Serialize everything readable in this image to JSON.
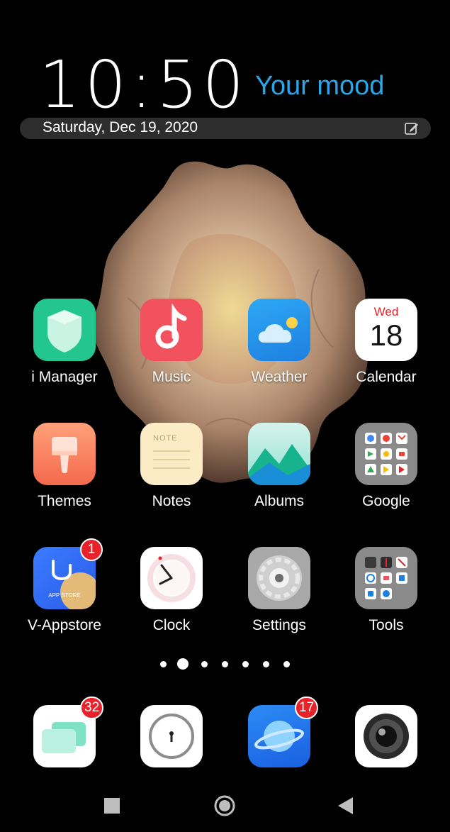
{
  "lockscreen": {
    "time": "10:50",
    "mood": "Your mood",
    "date": "Saturday, Dec 19, 2020"
  },
  "apps": [
    {
      "id": "i-manager",
      "label": "i Manager",
      "icon": "shield-icon"
    },
    {
      "id": "music",
      "label": "Music",
      "icon": "music-note-icon"
    },
    {
      "id": "weather",
      "label": "Weather",
      "icon": "cloud-sun-icon"
    },
    {
      "id": "calendar",
      "label": "Calendar",
      "icon": "calendar-icon",
      "day_name": "Wed",
      "day_number": "18"
    },
    {
      "id": "themes",
      "label": "Themes",
      "icon": "paintbrush-icon"
    },
    {
      "id": "notes",
      "label": "Notes",
      "icon": "notepad-icon",
      "icon_text": "NOTE"
    },
    {
      "id": "albums",
      "label": "Albums",
      "icon": "mountains-icon"
    },
    {
      "id": "google",
      "label": "Google",
      "icon": "folder-icon"
    },
    {
      "id": "v-appstore",
      "label": "V-Appstore",
      "icon": "appstore-icon",
      "icon_text": "APP STORE",
      "badge": "1"
    },
    {
      "id": "clock",
      "label": "Clock",
      "icon": "clock-icon"
    },
    {
      "id": "settings",
      "label": "Settings",
      "icon": "gear-icon"
    },
    {
      "id": "tools",
      "label": "Tools",
      "icon": "folder-icon"
    }
  ],
  "pager": {
    "count": 7,
    "active": 1
  },
  "dock": [
    {
      "id": "messages",
      "icon": "chat-bubbles-icon",
      "badge": "32"
    },
    {
      "id": "phone",
      "icon": "keyhole-icon"
    },
    {
      "id": "browser",
      "icon": "planet-icon",
      "badge": "17"
    },
    {
      "id": "camera",
      "icon": "camera-lens-icon"
    }
  ],
  "colors": {
    "mood_blue": "#2aa5e8",
    "badge_red": "#e8212b"
  }
}
